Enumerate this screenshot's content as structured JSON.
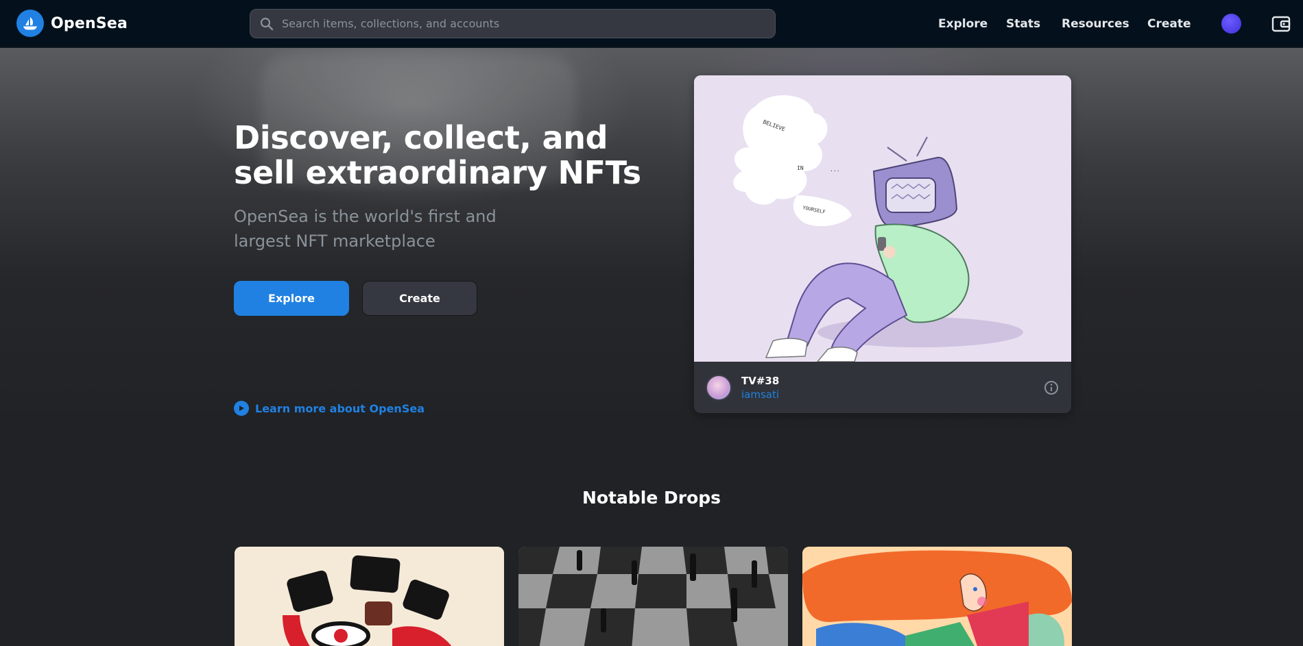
{
  "header": {
    "brand": "OpenSea",
    "search_placeholder": "Search items, collections, and accounts",
    "nav": [
      "Explore",
      "Stats",
      "Resources",
      "Create"
    ],
    "accent_color": "#2081e2",
    "icons": [
      "search-icon",
      "user-avatar",
      "wallet-icon"
    ]
  },
  "hero": {
    "title": "Discover, collect, and sell extraordinary NFTs",
    "subtitle": "OpenSea is the world's first and largest NFT marketplace",
    "explore_label": "Explore",
    "create_label": "Create",
    "learn_more": "Learn more about OpenSea"
  },
  "featured": {
    "name": "TV#38",
    "creator": "iamsati",
    "artwork_text": [
      "BELIEVE",
      "IN",
      "...",
      "YOURSELF"
    ]
  },
  "notable": {
    "title": "Notable Drops"
  }
}
